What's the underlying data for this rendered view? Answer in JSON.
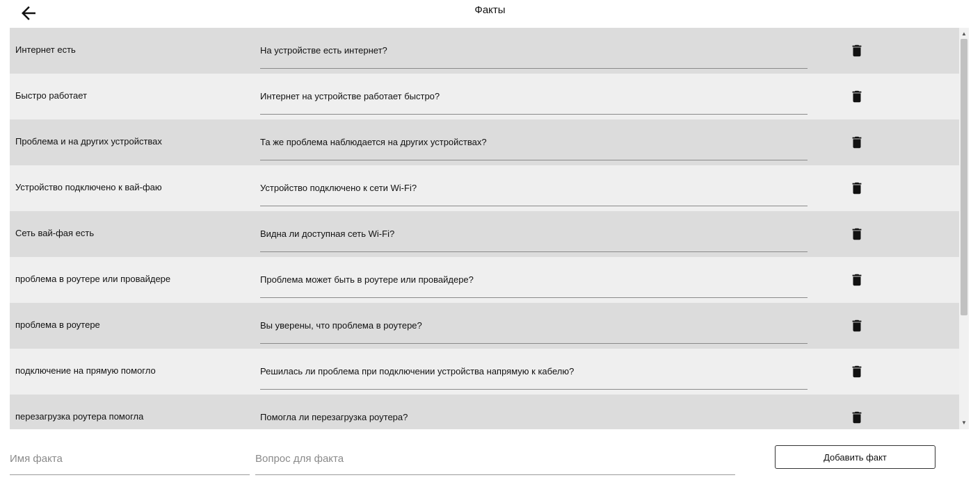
{
  "header": {
    "title": "Факты",
    "back_icon": "arrow-left-icon"
  },
  "facts": [
    {
      "name": "Интернет есть",
      "question": "На устройстве есть интернет?"
    },
    {
      "name": "Быстро работает",
      "question": "Интернет на устройстве работает быстро?"
    },
    {
      "name": "Проблема и на других устройствах",
      "question": "Та же проблема наблюдается на других устройствах?"
    },
    {
      "name": "Устройство подключено к вай-фаю",
      "question": "Устройство подключено к сети Wi-Fi?"
    },
    {
      "name": "Сеть вай-фая есть",
      "question": "Видна ли доступная сеть Wi-Fi?"
    },
    {
      "name": "проблема в роутере или провайдере",
      "question": "Проблема может быть в роутере или провайдере?"
    },
    {
      "name": "проблема в роутере",
      "question": "Вы уверены, что проблема в роутере?"
    },
    {
      "name": "подключение на прямую помогло",
      "question": "Решилась ли проблема при подключении устройства напрямую к кабелю?"
    },
    {
      "name": "перезагрузка роутера помогла",
      "question": "Помогла ли перезагрузка роутера?"
    }
  ],
  "row_action_icon": "trash-icon",
  "form": {
    "name_placeholder": "Имя факта",
    "question_placeholder": "Вопрос для факта",
    "name_value": "",
    "question_value": "",
    "add_label": "Добавить факт"
  },
  "colors": {
    "row_odd": "#dcdcdc",
    "row_even": "#efefef"
  }
}
